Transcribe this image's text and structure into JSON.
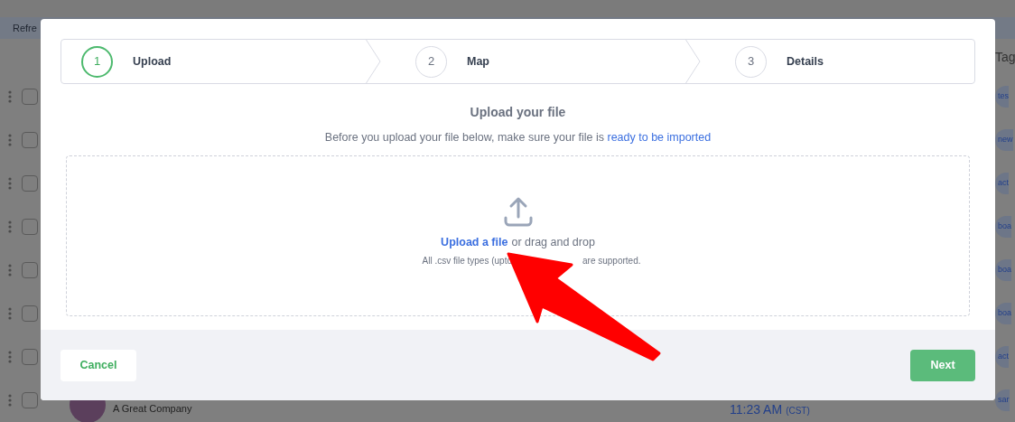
{
  "background": {
    "toolbar_label": "Refre",
    "column_header": "Tag",
    "rows": [
      {
        "checked": false,
        "tag": "tes"
      },
      {
        "checked": false,
        "tag": "new"
      },
      {
        "checked": false,
        "tag": "act"
      },
      {
        "checked": false,
        "tag": "boa"
      },
      {
        "checked": false,
        "tag": "boa"
      },
      {
        "checked": false,
        "tag": "boa"
      },
      {
        "checked": false,
        "tag": "act"
      },
      {
        "checked": false,
        "tag": "sar"
      }
    ],
    "last_row": {
      "company": "A Great Company",
      "time": "11:23 AM",
      "timezone": "(CST)"
    }
  },
  "modal": {
    "steps": [
      {
        "number": "1",
        "label": "Upload",
        "selected": true
      },
      {
        "number": "2",
        "label": "Map",
        "selected": false
      },
      {
        "number": "3",
        "label": "Details",
        "selected": false
      }
    ],
    "heading": "Upload your file",
    "intro": "Before you upload your file below, make sure your file is",
    "intro_link": "ready to be imported",
    "dropzone": {
      "link": "Upload a file",
      "text": "or drag and drop",
      "hint_start": "All .csv file types (upto",
      "hint_end": "are supported."
    },
    "buttons": {
      "cancel": "Cancel",
      "next": "Next"
    }
  }
}
